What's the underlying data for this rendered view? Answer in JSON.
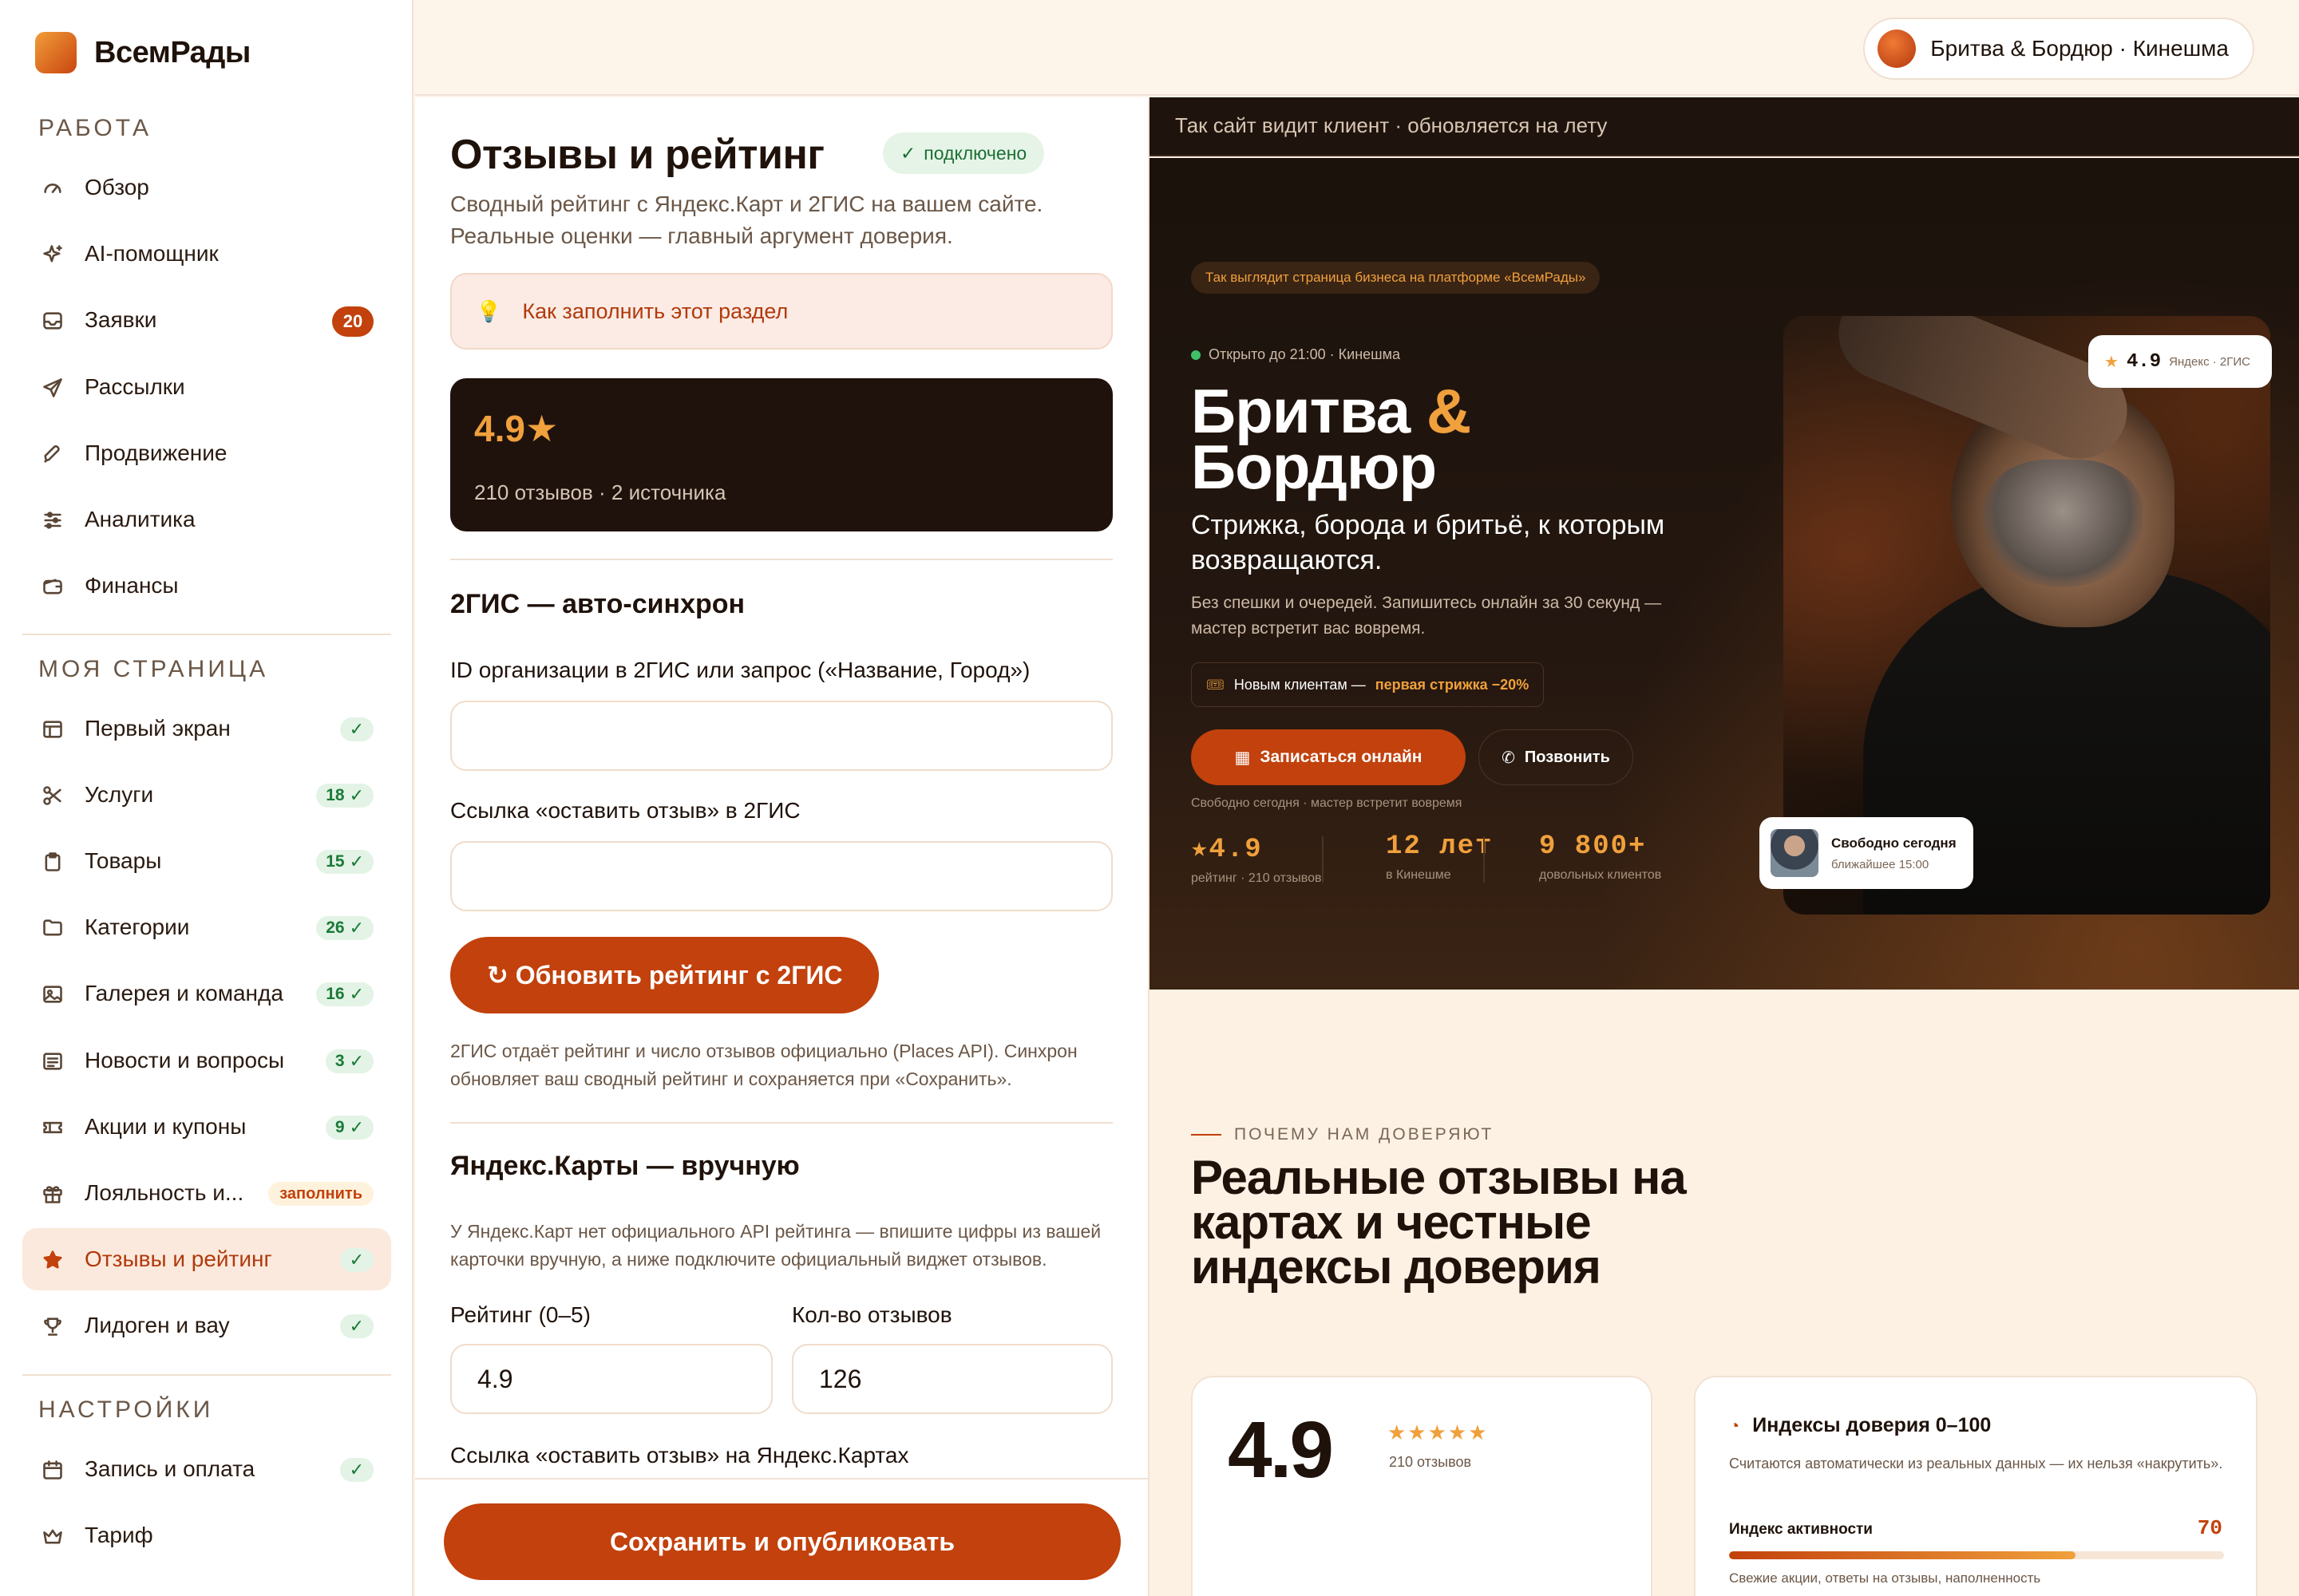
{
  "brand": {
    "name": "ВсемРады"
  },
  "sidebar": {
    "sections": [
      {
        "title": "РАБОТА"
      },
      {
        "title": "МОЯ  СТРАНИЦА"
      },
      {
        "title": "НАСТРОЙКИ"
      }
    ],
    "work": [
      {
        "label": "Обзор",
        "icon": "gauge-icon"
      },
      {
        "label": "AI-помощник",
        "icon": "sparkle-icon"
      },
      {
        "label": "Заявки",
        "icon": "inbox-icon",
        "badge": "20"
      },
      {
        "label": "Рассылки",
        "icon": "send-icon"
      },
      {
        "label": "Продвижение",
        "icon": "rocket-icon"
      },
      {
        "label": "Аналитика",
        "icon": "sliders-icon"
      },
      {
        "label": "Финансы",
        "icon": "wallet-icon"
      }
    ],
    "page": [
      {
        "label": "Первый экран",
        "icon": "layout-icon",
        "count": "",
        "status": "done"
      },
      {
        "label": "Услуги",
        "icon": "scissors-icon",
        "count": "18",
        "status": "done"
      },
      {
        "label": "Товары",
        "icon": "clipboard-icon",
        "count": "15",
        "status": "done"
      },
      {
        "label": "Категории",
        "icon": "folder-icon",
        "count": "26",
        "status": "done"
      },
      {
        "label": "Галерея и команда",
        "icon": "image-icon",
        "count": "16",
        "status": "done"
      },
      {
        "label": "Новости и вопросы",
        "icon": "news-icon",
        "count": "3",
        "status": "done"
      },
      {
        "label": "Акции и купоны",
        "icon": "ticket-icon",
        "count": "9",
        "status": "done"
      },
      {
        "label": "Лояльность и...",
        "icon": "gift-icon",
        "badge_text": "заполнить"
      },
      {
        "label": "Отзывы и рейтинг",
        "icon": "star-icon",
        "count": "",
        "status": "done",
        "active": true
      },
      {
        "label": "Лидоген и вау",
        "icon": "trophy-icon",
        "count": "",
        "status": "done"
      }
    ],
    "settings": [
      {
        "label": "Запись и оплата",
        "icon": "calendar-icon",
        "status": "done"
      },
      {
        "label": "Тариф",
        "icon": "crown-icon"
      }
    ]
  },
  "topbar": {
    "business": "Бритва & Бордюр · Кинешма"
  },
  "editor": {
    "title": "Отзывы и рейтинг",
    "connected": "подключено",
    "subtitle": "Сводный рейтинг с Яндекс.Карт и 2ГИС на вашем сайте. Реальные оценки — главный аргумент доверия.",
    "howto": "Как заполнить этот раздел",
    "summary": {
      "rating": "4.9★",
      "meta": "210 отзывов · 2 источника"
    },
    "gis": {
      "title": "2ГИС — авто-синхрон",
      "id_label": "ID организации в 2ГИС или запрос («Название, Город»)",
      "id_value": "",
      "link_label": "Ссылка «оставить отзыв» в 2ГИС",
      "link_value": "",
      "refresh_button": "↻ Обновить рейтинг с 2ГИС",
      "note": "2ГИС отдаёт рейтинг и число отзывов официально (Places API). Синхрон обновляет ваш сводный рейтинг и сохраняется при «Сохранить»."
    },
    "yandex": {
      "title": "Яндекс.Карты — вручную",
      "note": "У Яндекс.Карт нет официального API рейтинга — впишите цифры из вашей карточки вручную, а ниже подключите официальный виджет отзывов.",
      "rating_label": "Рейтинг (0–5)",
      "rating_value": "4.9",
      "count_label": "Кол-во отзывов",
      "count_value": "126",
      "link_label": "Ссылка «оставить отзыв» на Яндекс.Картах"
    },
    "save_button": "Сохранить и опубликовать"
  },
  "preview": {
    "caption": "Так сайт видит клиент · обновляется на лету",
    "tag": "Так выглядит страница бизнеса на платформе «ВсемРады»",
    "open": "Открыто до 21:00 · Кинешма",
    "title_a": "Бритва",
    "title_amp": "&",
    "title_b": "Бордюр",
    "subtitle": "Стрижка, борода и бритьё, к которым возвращаются.",
    "desc": "Без спешки и очередей. Запишитесь онлайн за 30 секунд — мастер встретит вас вовремя.",
    "promo_a": "Новым клиентам —",
    "promo_b": "первая стрижка −20%",
    "book": "Записаться онлайн",
    "call": "Позвонить",
    "free_note": "Свободно сегодня · мастер встретит вовремя",
    "stats": [
      {
        "value": "★4.9",
        "label": "рейтинг · 210 отзывов"
      },
      {
        "value": "12 лет",
        "label": "в Кинешме"
      },
      {
        "value": "9 800+",
        "label": "довольных клиентов"
      }
    ],
    "rating_chip": {
      "value": "4.9",
      "source": "Яндекс · 2ГИС"
    },
    "free_chip": {
      "title": "Свободно сегодня",
      "sub": "ближайшее 15:00"
    },
    "why": "ПОЧЕМУ НАМ ДОВЕРЯЮТ",
    "why_title": "Реальные отзывы на картах и честные индексы доверия",
    "card_rating": {
      "value": "4.9",
      "stars": "★★★★★",
      "count": "210 отзывов"
    },
    "card_index": {
      "title": "Индексы доверия 0–100",
      "desc": "Считаются автоматически из реальных данных — их нельзя «накрутить».",
      "index_label": "Индекс активности",
      "index_value": "70",
      "index_fill": 0.7,
      "index_desc": "Свежие акции, ответы на отзывы, наполненность"
    }
  },
  "colors": {
    "accent": "#c2410c",
    "gold": "#f0a03c",
    "dark": "#1f120c"
  }
}
